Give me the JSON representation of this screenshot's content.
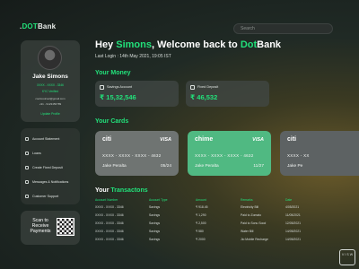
{
  "brand": {
    "prefix": ".",
    "accent": "DOT",
    "suffix": "Bank"
  },
  "search": {
    "placeholder": "Search"
  },
  "profile": {
    "name": "Jake Simons",
    "account": "XXXX - XXXX - 3346",
    "kyc": "KYC Verified",
    "email": "coolcoolcool@gmail.com",
    "phone": "+91 - 9123456789",
    "update_label": "Update Profile"
  },
  "nav": {
    "items": [
      {
        "label": "Account Statement",
        "icon": "statement-icon"
      },
      {
        "label": "Loans",
        "icon": "loan-icon"
      },
      {
        "label": "Create Fixed Deposit",
        "icon": "deposit-icon"
      },
      {
        "label": "Messages & Notifications",
        "icon": "message-icon"
      },
      {
        "label": "Customer Support",
        "icon": "support-icon"
      }
    ]
  },
  "qr": {
    "line1": "Scan to",
    "line2": "Receive",
    "line3": "Payments"
  },
  "header": {
    "greeting_pre": "Hey ",
    "greeting_name": "Simons",
    "greeting_mid": ", Welcome back to ",
    "greeting_brand": "Dot",
    "greeting_brand_suffix": "Bank",
    "last_login": "Last Login : 14th May 2021, 19:05 IST"
  },
  "money": {
    "title": "Your Money",
    "accounts": [
      {
        "label": "Savings Account",
        "value": "₹ 15,32,546"
      },
      {
        "label": "Fixed Deposit",
        "value": "₹ 46,532"
      }
    ]
  },
  "cards": {
    "title": "Your Cards",
    "items": [
      {
        "logo": "citi",
        "network": "VISA",
        "number": "XXXX - XXXX - XXXX - 4632",
        "holder": "Jake Peralta",
        "expiry": "05/24",
        "color": "#6f7472"
      },
      {
        "logo": "chime",
        "network": "VISA",
        "number": "XXXX - XXXX - XXXX - 4632",
        "holder": "Jake Peralta",
        "expiry": "11/27",
        "color": "#50b982"
      },
      {
        "logo": "citi",
        "network": "",
        "number": "XXXX - XX",
        "holder": "Jake Pe",
        "expiry": "",
        "color": "#5d6263"
      }
    ]
  },
  "transactions": {
    "title_pre": "Your ",
    "title_accent": "Transactons",
    "columns": [
      "Account Number",
      "Account Type",
      "Amount",
      "Remarks",
      "Date"
    ],
    "rows": [
      [
        "XXXX - XXXX - 3346",
        "Savings",
        "₹ 918.45",
        "Electricity Bill",
        "4/05/2021"
      ],
      [
        "XXXX - XXXX - 3346",
        "Savings",
        "₹ 1,290",
        "Paid to Zomato",
        "11/05/2021"
      ],
      [
        "XXXX - XXXX - 3346",
        "Savings",
        "₹ 2,500",
        "Paid to Sonu Sood",
        "12/05/2021"
      ],
      [
        "XXXX - XXXX - 3346",
        "Savings",
        "₹ 580",
        "Water Bill",
        "14/05/2021"
      ],
      [
        "XXXX - XXXX - 3346",
        "Savings",
        "₹ 2000",
        "Jio Mobile Recharge",
        "14/05/2021"
      ]
    ]
  },
  "badge": {
    "text": "V I S W"
  }
}
